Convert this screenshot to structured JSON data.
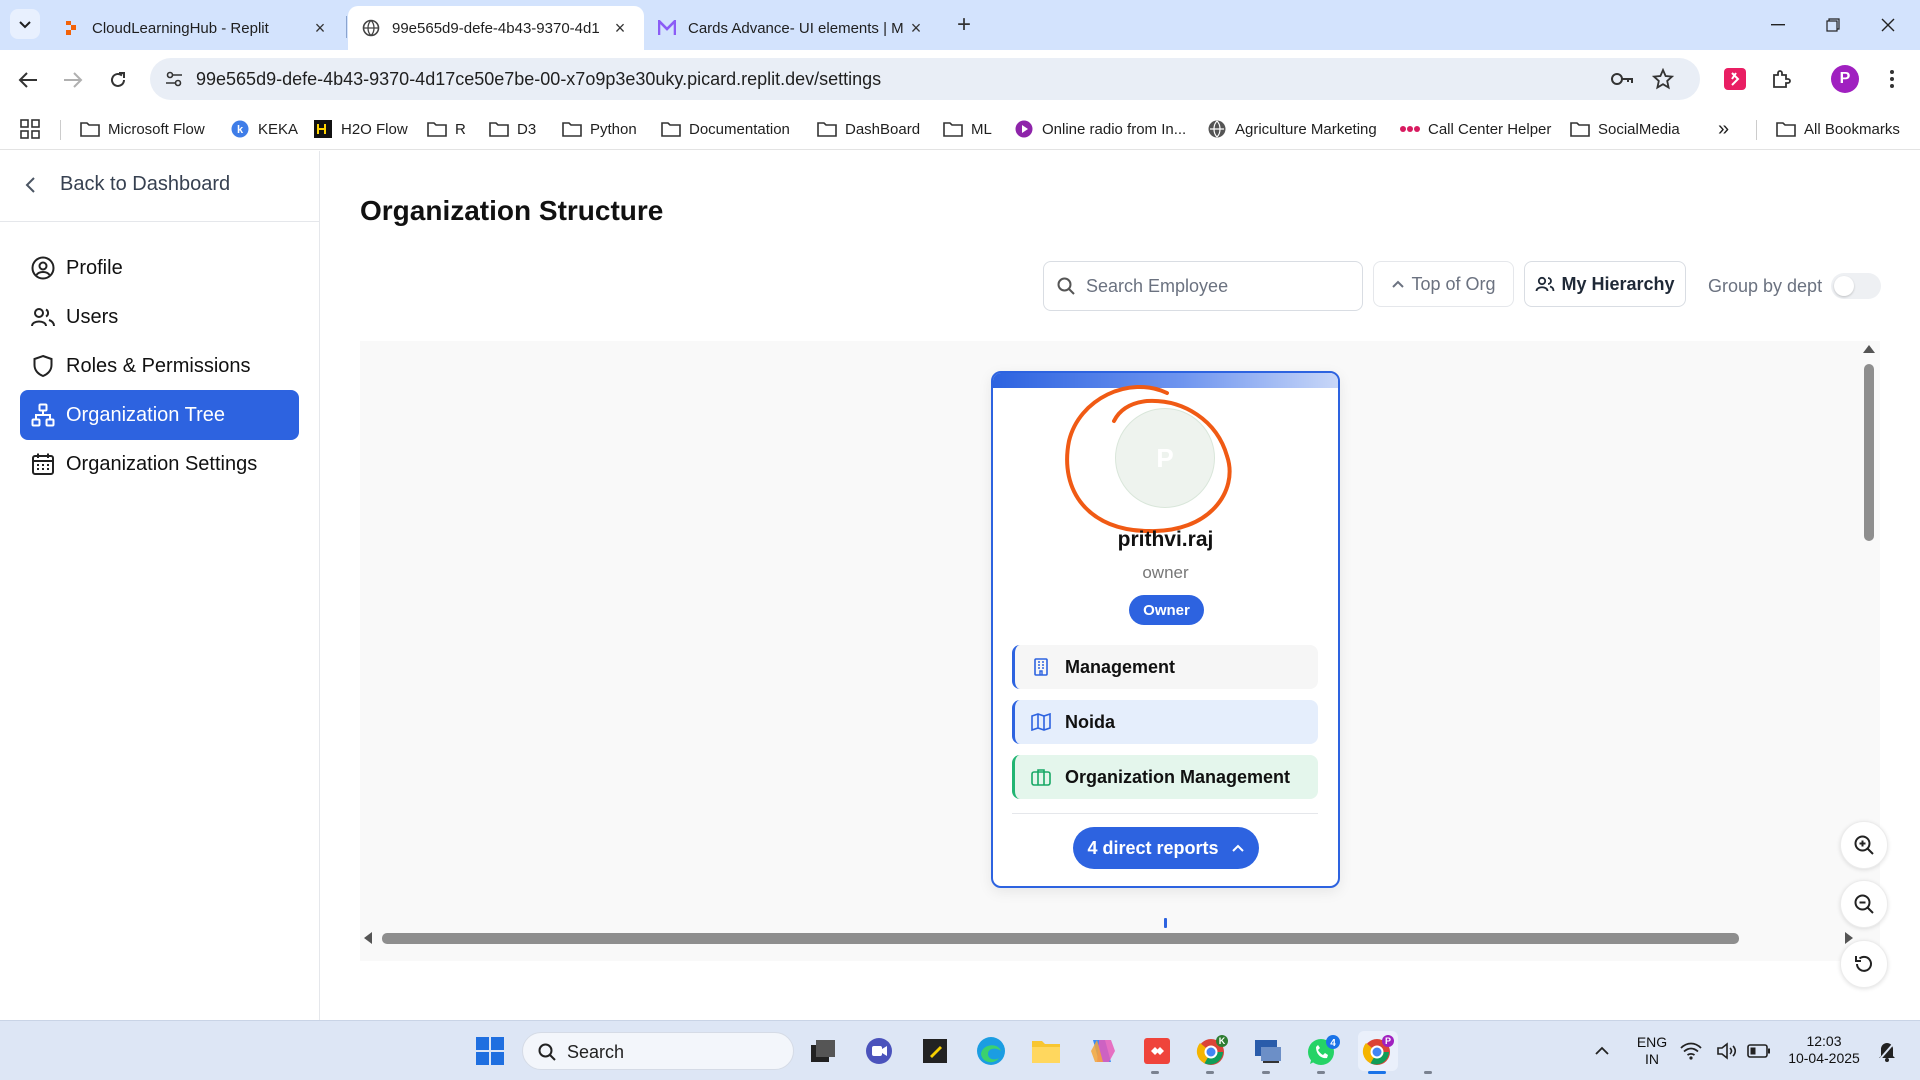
{
  "browser": {
    "tabs": [
      {
        "title": "CloudLearningHub - Replit",
        "favicon": "replit-icon"
      },
      {
        "title": "99e565d9-defe-4b43-9370-4d1",
        "favicon": "globe-icon"
      },
      {
        "title": "Cards Advance- UI elements | M",
        "favicon": "m-logo-icon"
      }
    ],
    "new_tab_label": "+",
    "address": "99e565d9-defe-4b43-9370-4d17ce50e7be-00-x7o9p3e30uky.picard.replit.dev/settings",
    "profile_initial": "P",
    "bookmarks": [
      {
        "label": "Microsoft Flow",
        "icon": "folder-icon"
      },
      {
        "label": "KEKA",
        "icon": "keka-icon"
      },
      {
        "label": "H2O Flow",
        "icon": "h2o-icon"
      },
      {
        "label": "R",
        "icon": "folder-icon"
      },
      {
        "label": "D3",
        "icon": "folder-icon"
      },
      {
        "label": "Python",
        "icon": "folder-icon"
      },
      {
        "label": "Documentation",
        "icon": "folder-icon"
      },
      {
        "label": "DashBoard",
        "icon": "folder-icon"
      },
      {
        "label": "ML",
        "icon": "folder-icon"
      },
      {
        "label": "Online radio from In...",
        "icon": "radio-icon"
      },
      {
        "label": "Agriculture Marketing",
        "icon": "globe-icon"
      },
      {
        "label": "Call Center Helper",
        "icon": "dots-icon"
      },
      {
        "label": "SocialMedia",
        "icon": "folder-icon"
      }
    ],
    "more_bookmarks": "»",
    "all_bookmarks": "All Bookmarks"
  },
  "sidebar": {
    "back_label": "Back to Dashboard",
    "items": [
      {
        "label": "Profile",
        "icon": "user-circle-icon",
        "active": false
      },
      {
        "label": "Users",
        "icon": "users-icon",
        "active": false
      },
      {
        "label": "Roles & Permissions",
        "icon": "shield-icon",
        "active": false
      },
      {
        "label": "Organization Tree",
        "icon": "org-tree-icon",
        "active": true
      },
      {
        "label": "Organization Settings",
        "icon": "calendar-icon",
        "active": false
      }
    ]
  },
  "main": {
    "title": "Organization Structure",
    "search_placeholder": "Search Employee",
    "top_of_org_label": "Top of Org",
    "my_hierarchy_label": "My Hierarchy",
    "group_by_label": "Group by dept",
    "group_by_enabled": false,
    "accent_color": "#2d63e0"
  },
  "card": {
    "avatar_initial": "P",
    "name": "prithvi.raj",
    "role": "owner",
    "badge": "Owner",
    "department": "Management",
    "location": "Noida",
    "team": "Organization Management",
    "reports_label": "4 direct reports",
    "annotation_color": "#f05a14"
  },
  "taskbar": {
    "search_label": "Search",
    "language": "ENG",
    "region": "IN",
    "time": "12:03",
    "date": "10-04-2025",
    "whatsapp_badge": "4",
    "chrome_k_badge": "K",
    "chrome_p_badge": "P"
  }
}
